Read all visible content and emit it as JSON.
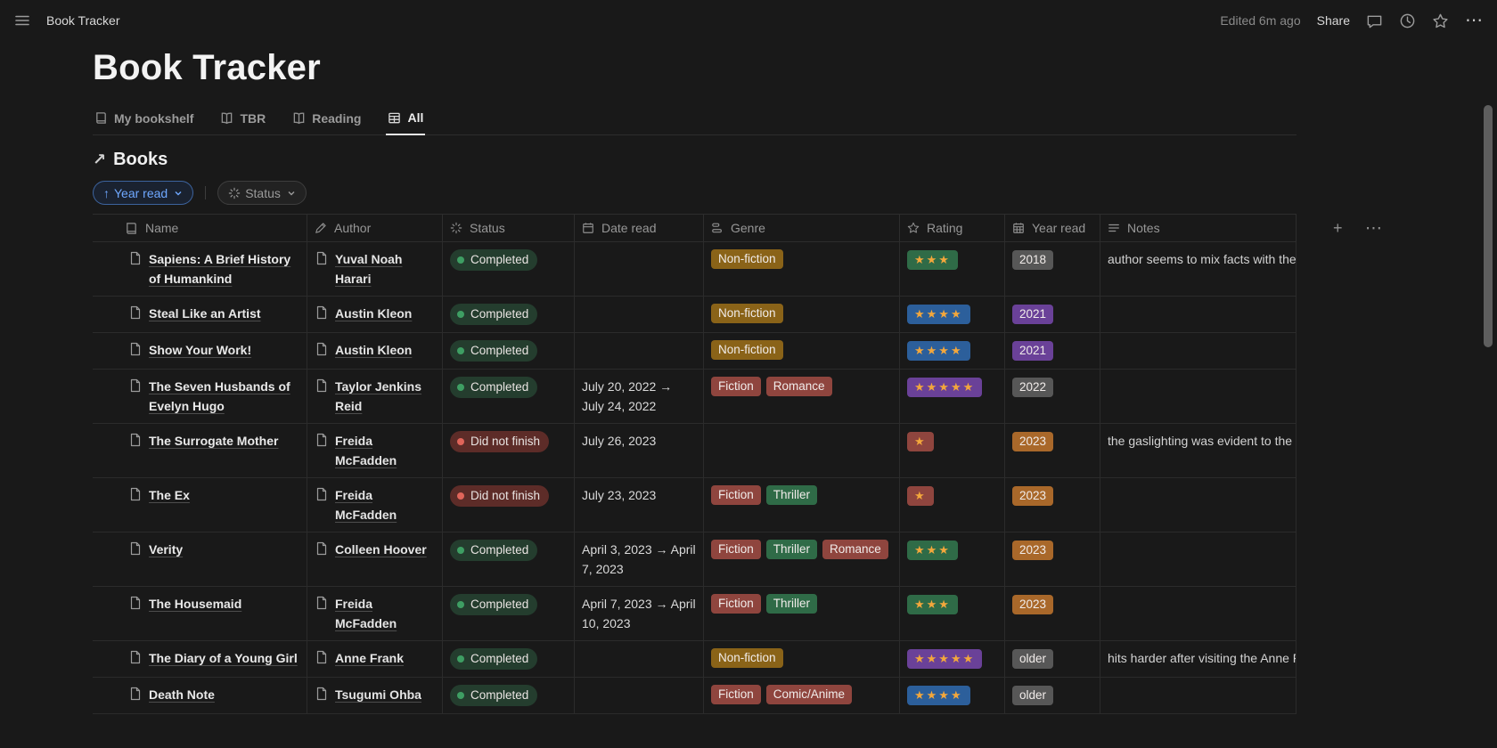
{
  "topbar": {
    "title": "Book Tracker",
    "edited": "Edited 6m ago",
    "share_label": "Share",
    "more_glyph": "⋯"
  },
  "icons": {
    "topbar": [
      "menu-icon",
      "comments-icon",
      "history-clock-icon",
      "favorite-star-icon",
      "more-ellipsis-icon"
    ],
    "tabs": [
      "bookshelf-icon",
      "book-icon",
      "open-book-icon",
      "table-view-icon"
    ],
    "table_columns": [
      "page-icon",
      "pencil-icon",
      "status-burst-icon",
      "calendar-icon",
      "multi-select-icon",
      "star-icon",
      "calendar-grid-icon",
      "text-lines-icon"
    ],
    "row_item_icon": "page-icon"
  },
  "page": {
    "title": "Book Tracker",
    "tabs": [
      {
        "label": "My bookshelf",
        "active": false
      },
      {
        "label": "TBR",
        "active": false
      },
      {
        "label": "Reading",
        "active": false
      },
      {
        "label": "All",
        "active": true
      }
    ],
    "section": {
      "arrow": "↗",
      "title": "Books"
    },
    "filters": {
      "sort_arrow": "↑",
      "sort_label": "Year read",
      "status_label": "Status"
    }
  },
  "table": {
    "columns": [
      {
        "label": "Name"
      },
      {
        "label": "Author"
      },
      {
        "label": "Status"
      },
      {
        "label": "Date read"
      },
      {
        "label": "Genre"
      },
      {
        "label": "Rating"
      },
      {
        "label": "Year read"
      },
      {
        "label": "Notes"
      }
    ],
    "add_column_glyph": "+",
    "more_glyph": "⋯",
    "rows": [
      {
        "name": "Sapiens: A Brief History of Humankind",
        "author": "Yuval Noah Harari",
        "status": "Completed",
        "status_color": "green",
        "date_read": "",
        "genres": [
          {
            "label": "Non-fiction",
            "color": "yellow"
          }
        ],
        "rating_stars": 3,
        "rating_color": "green",
        "year_read": "2018",
        "year_color": "gray",
        "notes": "author seems to mix facts with theo"
      },
      {
        "name": "Steal Like an Artist",
        "author": "Austin Kleon",
        "status": "Completed",
        "status_color": "green",
        "date_read": "",
        "genres": [
          {
            "label": "Non-fiction",
            "color": "yellow"
          }
        ],
        "rating_stars": 4,
        "rating_color": "blue",
        "year_read": "2021",
        "year_color": "purple",
        "notes": ""
      },
      {
        "name": "Show Your Work!",
        "author": "Austin Kleon",
        "status": "Completed",
        "status_color": "green",
        "date_read": "",
        "genres": [
          {
            "label": "Non-fiction",
            "color": "yellow"
          }
        ],
        "rating_stars": 4,
        "rating_color": "blue",
        "year_read": "2021",
        "year_color": "purple",
        "notes": ""
      },
      {
        "name": "The Seven Husbands of Evelyn Hugo",
        "author": "Taylor Jenkins Reid",
        "status": "Completed",
        "status_color": "green",
        "date_read": "July 20, 2022 → July 24, 2022",
        "genres": [
          {
            "label": "Fiction",
            "color": "red"
          },
          {
            "label": "Romance",
            "color": "red"
          }
        ],
        "rating_stars": 5,
        "rating_color": "purple",
        "year_read": "2022",
        "year_color": "gray",
        "notes": ""
      },
      {
        "name": "The Surrogate Mother",
        "author": "Freida McFadden",
        "status": "Did not finish",
        "status_color": "red",
        "date_read": "July 26, 2023",
        "genres": [],
        "rating_stars": 1,
        "rating_color": "red",
        "year_read": "2023",
        "year_color": "orange",
        "notes": "the gaslighting was evident to the p"
      },
      {
        "name": "The Ex",
        "author": "Freida McFadden",
        "status": "Did not finish",
        "status_color": "red",
        "date_read": "July 23, 2023",
        "genres": [
          {
            "label": "Fiction",
            "color": "red"
          },
          {
            "label": "Thriller",
            "color": "green"
          }
        ],
        "rating_stars": 1,
        "rating_color": "red",
        "year_read": "2023",
        "year_color": "orange",
        "notes": ""
      },
      {
        "name": "Verity",
        "author": "Colleen Hoover",
        "status": "Completed",
        "status_color": "green",
        "date_read": "April 3, 2023 → April 7, 2023",
        "genres": [
          {
            "label": "Fiction",
            "color": "red"
          },
          {
            "label": "Thriller",
            "color": "green"
          },
          {
            "label": "Romance",
            "color": "red"
          }
        ],
        "rating_stars": 3,
        "rating_color": "green",
        "year_read": "2023",
        "year_color": "orange",
        "notes": ""
      },
      {
        "name": "The Housemaid",
        "author": "Freida McFadden",
        "status": "Completed",
        "status_color": "green",
        "date_read": "April 7, 2023 → April 10, 2023",
        "genres": [
          {
            "label": "Fiction",
            "color": "red"
          },
          {
            "label": "Thriller",
            "color": "green"
          }
        ],
        "rating_stars": 3,
        "rating_color": "green",
        "year_read": "2023",
        "year_color": "orange",
        "notes": ""
      },
      {
        "name": "The Diary of a Young Girl",
        "author": "Anne Frank",
        "status": "Completed",
        "status_color": "green",
        "date_read": "",
        "genres": [
          {
            "label": "Non-fiction",
            "color": "yellow"
          }
        ],
        "rating_stars": 5,
        "rating_color": "purple",
        "year_read": "older",
        "year_color": "gray",
        "notes": "hits harder after visiting the Anne F"
      },
      {
        "name": "Death Note",
        "author": "Tsugumi Ohba",
        "status": "Completed",
        "status_color": "green",
        "date_read": "",
        "genres": [
          {
            "label": "Fiction",
            "color": "red"
          },
          {
            "label": "Comic/Anime",
            "color": "red"
          }
        ],
        "rating_stars": 4,
        "rating_color": "blue",
        "year_read": "older",
        "year_color": "gray",
        "notes": ""
      }
    ]
  },
  "colors": {
    "background": "#191919",
    "accent_blue": "#6fa8ff",
    "star": "#f3a73c",
    "tag": {
      "red": "#8f453e",
      "green": "#2f6b47",
      "yellow": "#8a6318",
      "gray": "#575757",
      "purple": "#6a4198",
      "orange": "#a9682a",
      "blue": "#2c5f9b"
    },
    "status": {
      "green": {
        "bg": "#243d2e",
        "dot": "#3e9e63"
      },
      "red": {
        "bg": "#5d2c28",
        "dot": "#e0655a"
      }
    }
  }
}
